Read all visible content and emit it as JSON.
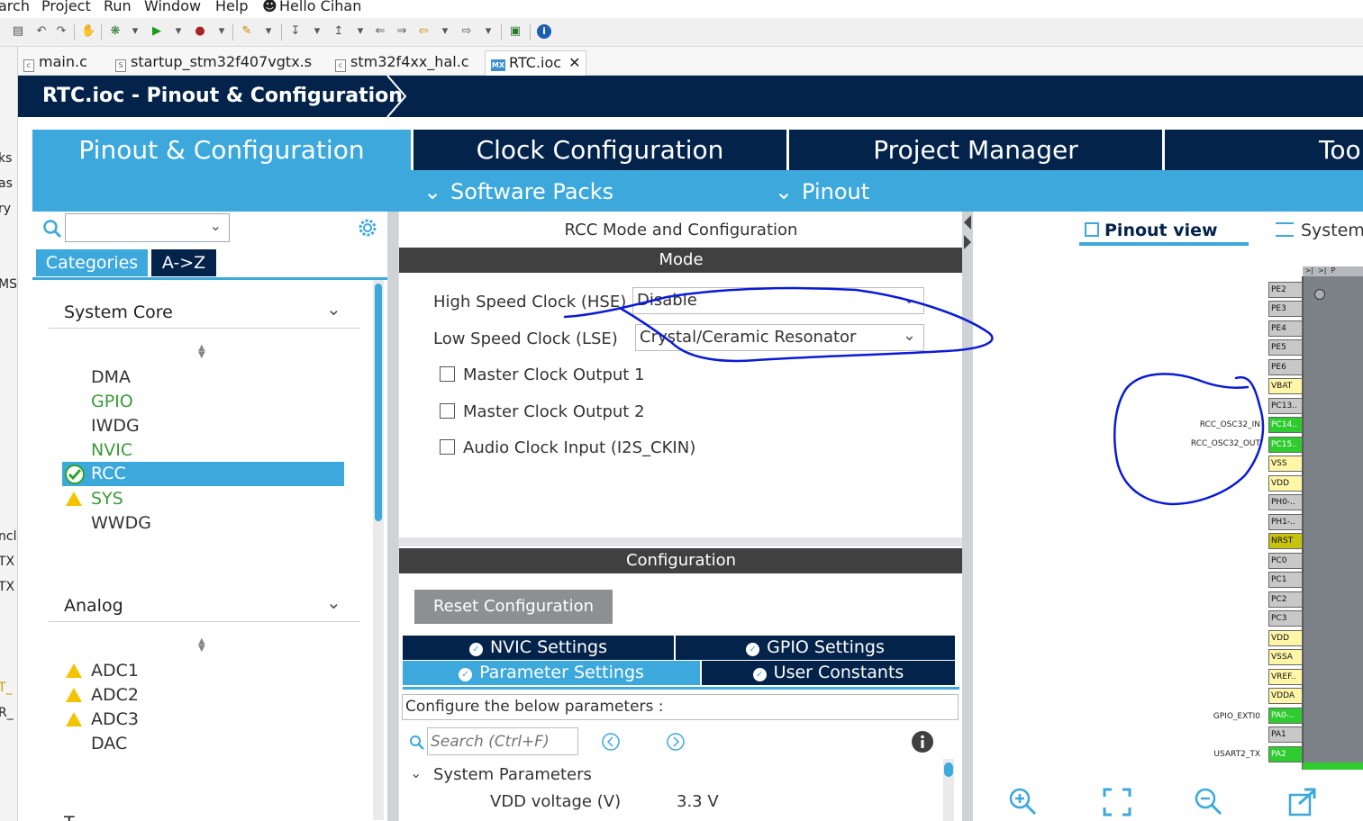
{
  "menu": [
    "arch",
    "Project",
    "Run",
    "Window",
    "Help",
    "Hello Cihan"
  ],
  "left_strip": [
    "ks",
    "as",
    "ry",
    "MS",
    "ncl",
    "TX",
    "TX",
    "T_",
    "R_"
  ],
  "editor_tabs": [
    "main.c",
    "startup_stm32f407vgtx.s",
    "stm32f4xx_hal.c",
    "RTC.ioc"
  ],
  "tab_icon_mx": "MX",
  "banner_title": "RTC.ioc - Pinout & Configuration",
  "main_tabs": [
    "Pinout & Configuration",
    "Clock Configuration",
    "Project Manager",
    "Too"
  ],
  "sub_menu": [
    "Software Packs",
    "Pinout"
  ],
  "left": {
    "category_tabs": [
      "Categories",
      "A->Z"
    ],
    "groups": [
      {
        "title": "System Core",
        "items": [
          "DMA",
          "GPIO",
          "IWDG",
          "NVIC",
          "RCC",
          "SYS",
          "WWDG"
        ]
      },
      {
        "title": "Analog",
        "items": [
          "ADC1",
          "ADC2",
          "ADC3",
          "DAC"
        ]
      }
    ],
    "next_group_partial": "T..."
  },
  "center": {
    "title": "RCC Mode and Configuration",
    "mode_band": "Mode",
    "hse_label": "High Speed Clock (HSE)",
    "hse_value": "Disable",
    "lse_label": "Low Speed Clock (LSE)",
    "lse_value": "Crystal/Ceramic Resonator",
    "checkboxes": [
      "Master Clock Output 1",
      "Master Clock Output 2",
      "Audio Clock Input (I2S_CKIN)"
    ],
    "config_band": "Configuration",
    "reset_button": "Reset Configuration",
    "settings_tabs": [
      "NVIC Settings",
      "GPIO Settings",
      "Parameter Settings",
      "User Constants"
    ],
    "configure_text": "Configure the below parameters :",
    "search_placeholder": "Search (Ctrl+F)",
    "section": "System Parameters",
    "param_label": "VDD voltage (V)",
    "param_value": "3.3 V"
  },
  "right": {
    "view_tabs": [
      "Pinout view",
      "System"
    ],
    "pins": [
      "PE2",
      "PE3",
      "PE4",
      "PE5",
      "PE6",
      "VBAT",
      "PC13..",
      "PC14..",
      "PC15..",
      "VSS",
      "VDD",
      "PH0-..",
      "PH1-..",
      "NRST",
      "PC0",
      "PC1",
      "PC2",
      "PC3",
      "VDD",
      "VSSA",
      "VREF..",
      "VDDA",
      "PA0-..",
      "PA1",
      "PA2"
    ],
    "pin_labels": [
      "RCC_OSC32_IN",
      "RCC_OSC32_OUT",
      "GPIO_EXTI0",
      "USART2_TX"
    ]
  },
  "colors": {
    "navy": "#03234b",
    "accent": "#3ca8dc",
    "band": "#404040",
    "pin_green": "#2ecc2e",
    "annotation": "#0a1bd6"
  }
}
